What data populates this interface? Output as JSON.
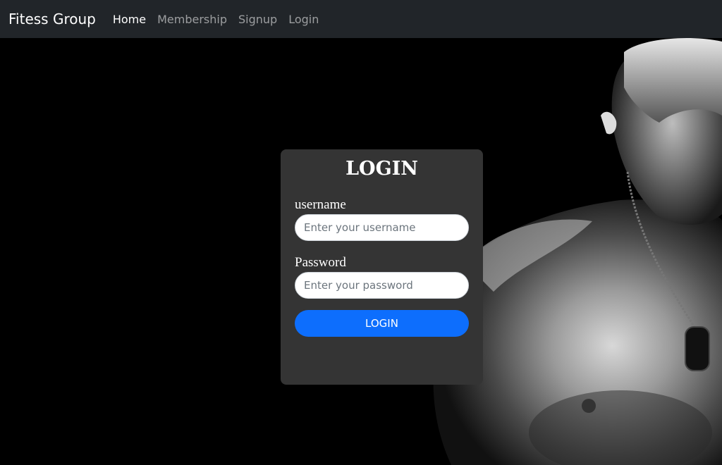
{
  "navbar": {
    "brand": "Fitess Group",
    "links": [
      {
        "label": "Home",
        "active": true
      },
      {
        "label": "Membership",
        "active": false
      },
      {
        "label": "Signup",
        "active": false
      },
      {
        "label": "Login",
        "active": false
      }
    ],
    "background": "#212529"
  },
  "login": {
    "title": "LOGIN",
    "username_label": "username",
    "username_placeholder": "Enter your username",
    "username_value": "",
    "password_label": "Password",
    "password_placeholder": "Enter your password",
    "password_value": "",
    "button_label": "LOGIN",
    "card_color": "#343434",
    "button_color": "#0d6efd"
  }
}
